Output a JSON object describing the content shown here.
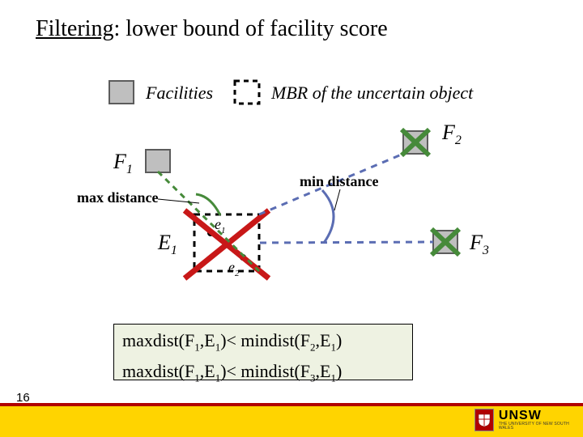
{
  "title_underlined": "Filtering",
  "title_rest": ": lower bound of facility score",
  "legend": {
    "facilities": "Facilities",
    "mbr": "MBR of the uncertain object"
  },
  "labels": {
    "F1": "F",
    "F1_sub": "1",
    "F2": "F",
    "F2_sub": "2",
    "F3": "F",
    "F3_sub": "3",
    "E1": "E",
    "E1_sub": "1",
    "e1": "e",
    "e1_sub": "1",
    "e2": "e",
    "e2_sub": "2",
    "max_distance": "max distance",
    "min_distance": "min distance"
  },
  "inequalities": {
    "line1_a": "maxdist(F",
    "line1_a_sub": "1",
    "line1_b": ",E",
    "line1_b_sub": "1",
    "line1_c": ")< mindist(F",
    "line1_c_sub": "2",
    "line1_d": ",E",
    "line1_d_sub": "1",
    "line1_e": ")",
    "line2_a": "maxdist(F",
    "line2_a_sub": "1",
    "line2_b": ",E",
    "line2_b_sub": "1",
    "line2_c": ")< mindist(F",
    "line2_c_sub": "3",
    "line2_d": ",E",
    "line2_d_sub": "1",
    "line2_e": ")"
  },
  "footer": {
    "page": "16",
    "org": "UNSW",
    "org_sub": "THE UNIVERSITY OF NEW SOUTH WALES"
  },
  "colors": {
    "green": "#468a3a",
    "blue": "#5b6db3",
    "red": "#c81818",
    "gray_fill": "#bfbfbf",
    "gray_stroke": "#5c5c5c"
  }
}
